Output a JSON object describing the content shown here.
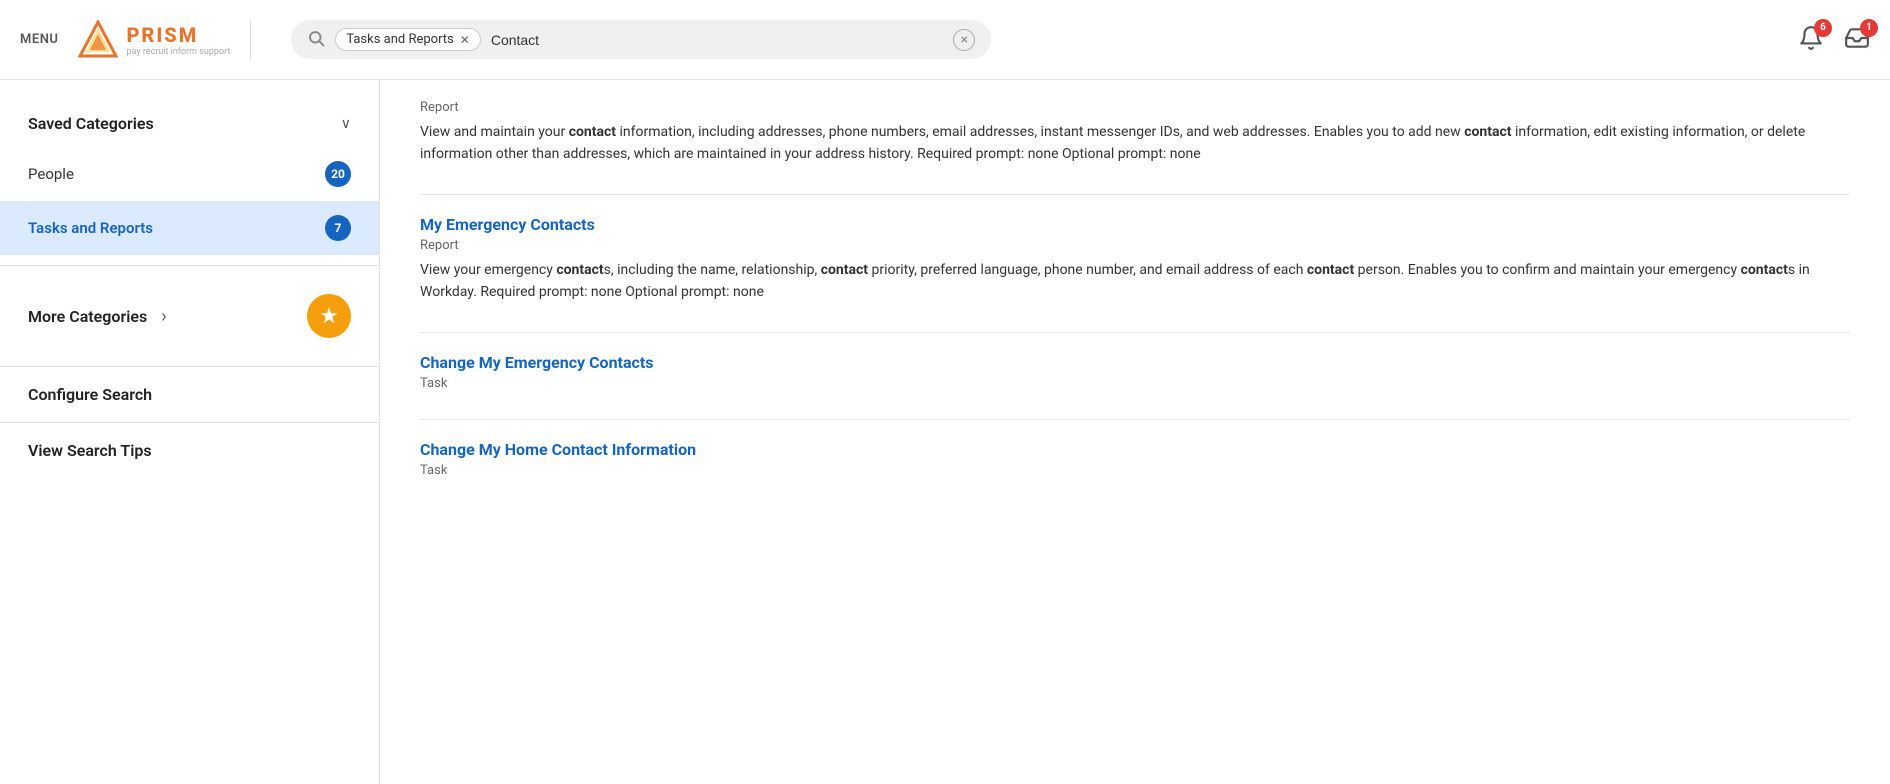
{
  "header": {
    "menu_label": "MENU",
    "logo_text": "PRISM",
    "logo_subtitle": "pay recruit inform support",
    "search": {
      "tag_label": "Tasks and Reports",
      "search_value": "Contact",
      "placeholder": "Contact",
      "clear_icon": "×"
    },
    "notifications_count": 6,
    "inbox_count": 1
  },
  "sidebar": {
    "saved_categories_label": "Saved Categories",
    "chevron_label": "∨",
    "items": [
      {
        "label": "People",
        "badge": 20,
        "active": false
      },
      {
        "label": "Tasks and Reports",
        "badge": 7,
        "active": true
      }
    ],
    "more_categories_label": "More Categories",
    "chevron_right": "›",
    "star_icon": "★",
    "configure_search_label": "Configure Search",
    "view_search_tips_label": "View Search Tips"
  },
  "main": {
    "results": [
      {
        "id": "contact-report",
        "type": "Report",
        "title": null,
        "description_parts": [
          {
            "text": "View and maintain your ",
            "bold": false
          },
          {
            "text": "contact",
            "bold": true
          },
          {
            "text": " information, including addresses, phone numbers, email addresses, instant messenger IDs, and web addresses. Enables you to add new ",
            "bold": false
          },
          {
            "text": "contact",
            "bold": true
          },
          {
            "text": " information, edit existing information, or delete information other than addresses, which are maintained in your address history. Required prompt: none Optional prompt: none",
            "bold": false
          }
        ]
      },
      {
        "id": "my-emergency-contacts",
        "type": "Report",
        "title": "My Emergency Contacts",
        "description_parts": [
          {
            "text": "View your emergency ",
            "bold": false
          },
          {
            "text": "contact",
            "bold": true
          },
          {
            "text": "s, including the name, relationship, ",
            "bold": false
          },
          {
            "text": "contact",
            "bold": true
          },
          {
            "text": " priority, preferred language, phone number, and email address of each ",
            "bold": false
          },
          {
            "text": "contact",
            "bold": true
          },
          {
            "text": " person. Enables you to confirm and maintain your emergency ",
            "bold": false
          },
          {
            "text": "contact",
            "bold": true
          },
          {
            "text": "s in Workday. Required prompt: none Optional prompt: none",
            "bold": false
          }
        ]
      },
      {
        "id": "change-my-emergency-contacts",
        "type": "Task",
        "title": "Change My Emergency Contacts",
        "description_parts": []
      },
      {
        "id": "change-my-home-contact",
        "type": "Task",
        "title": "Change My Home Contact Information",
        "description_parts": []
      }
    ]
  }
}
